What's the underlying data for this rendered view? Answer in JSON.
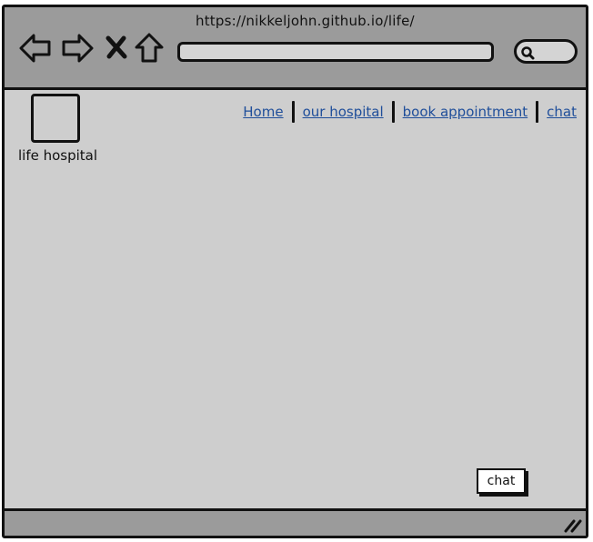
{
  "browser": {
    "url": "https://nikkeljohn.github.io/life/"
  },
  "icons": {
    "back": "arrow-left-icon",
    "forward": "arrow-right-icon",
    "stop": "close-icon",
    "home": "home-icon",
    "search": "search-icon",
    "resize": "resize-handle-icon"
  },
  "site": {
    "title": "life hospital"
  },
  "nav": {
    "items": [
      {
        "label": "Home"
      },
      {
        "label": "our hospital"
      },
      {
        "label": "book appointment"
      },
      {
        "label": "chat"
      }
    ]
  },
  "chat_widget": {
    "label": "chat"
  },
  "colors": {
    "chrome": "#9b9b9b",
    "page_background": "#cecece",
    "link": "#1f4e9a",
    "outline": "#111111"
  }
}
